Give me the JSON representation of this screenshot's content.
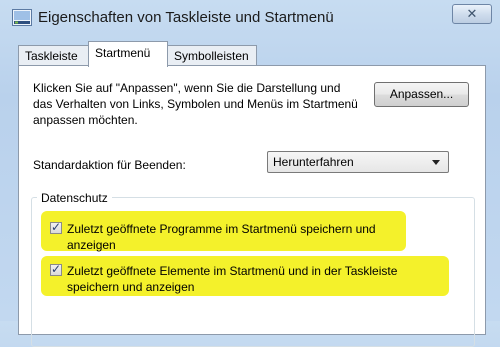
{
  "window": {
    "title": "Eigenschaften von Taskleiste und Startmenü",
    "close_glyph": "✕"
  },
  "tabs": [
    {
      "label": "Taskleiste",
      "selected": false
    },
    {
      "label": "Startmenü",
      "selected": true
    },
    {
      "label": "Symbolleisten",
      "selected": false
    }
  ],
  "startmenu": {
    "intro_text": "Klicken Sie auf \"Anpassen\", wenn Sie die Darstellung und das Verhalten von Links, Symbolen und Menüs im Startmenü anpassen möchten.",
    "customize_button": "Anpassen...",
    "shutdown_label": "Standardaktion für Beenden:",
    "shutdown_value": "Herunterfahren"
  },
  "privacy": {
    "legend": "Datenschutz",
    "options": [
      {
        "label": "Zuletzt geöffnete Programme im Startmenü speichern und anzeigen",
        "checked": true
      },
      {
        "label": "Zuletzt geöffnete Elemente im Startmenü und in der Taskleiste speichern und anzeigen",
        "checked": true
      }
    ],
    "check_glyph": "✓",
    "highlight_color": "#f4f12b"
  },
  "icons": {
    "window_icon": "taskbar-properties-icon",
    "close": "close-icon",
    "dropdown": "chevron-down-icon",
    "checkbox": "checkmark-icon"
  }
}
